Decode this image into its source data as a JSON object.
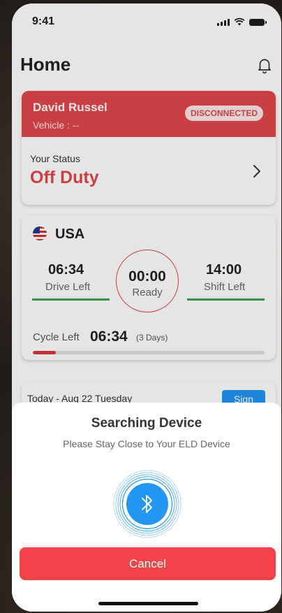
{
  "status_bar": {
    "time": "9:41",
    "signal_icon": "cellular-signal-icon",
    "wifi_icon": "wifi-icon",
    "battery_icon": "battery-icon"
  },
  "header": {
    "title": "Home",
    "notification_icon": "bell-icon"
  },
  "status_card": {
    "driver_name": "David Russel",
    "vehicle": "Vehicle : --",
    "connection_badge": "DISCONNECTED",
    "status_label": "Your Status",
    "status_value": "Off Duty",
    "chevron_icon": "chevron-right-icon"
  },
  "clock_card": {
    "flag_icon": "us-flag-icon",
    "country": "USA",
    "drive_time": "06:34",
    "drive_label": "Drive Left",
    "center_time": "00:00",
    "center_label": "Ready",
    "shift_time": "14:00",
    "shift_label": "Shift Left",
    "cycle_label": "Cycle Left",
    "cycle_time": "06:34",
    "cycle_days": "(3 Days)",
    "cycle_progress": 0.1
  },
  "log_card": {
    "date": "Today - Aug 22 Tuesday",
    "sign_label": "Sign"
  },
  "sheet": {
    "title": "Searching Device",
    "subtitle": "Please Stay Close to Your ELD Device",
    "bluetooth_icon": "bluetooth-icon",
    "cancel_label": "Cancel"
  },
  "colors": {
    "accent_red": "#e0474a",
    "accent_blue": "#2196f3",
    "status_green": "#3ba24a",
    "cancel_red": "#f04448"
  }
}
